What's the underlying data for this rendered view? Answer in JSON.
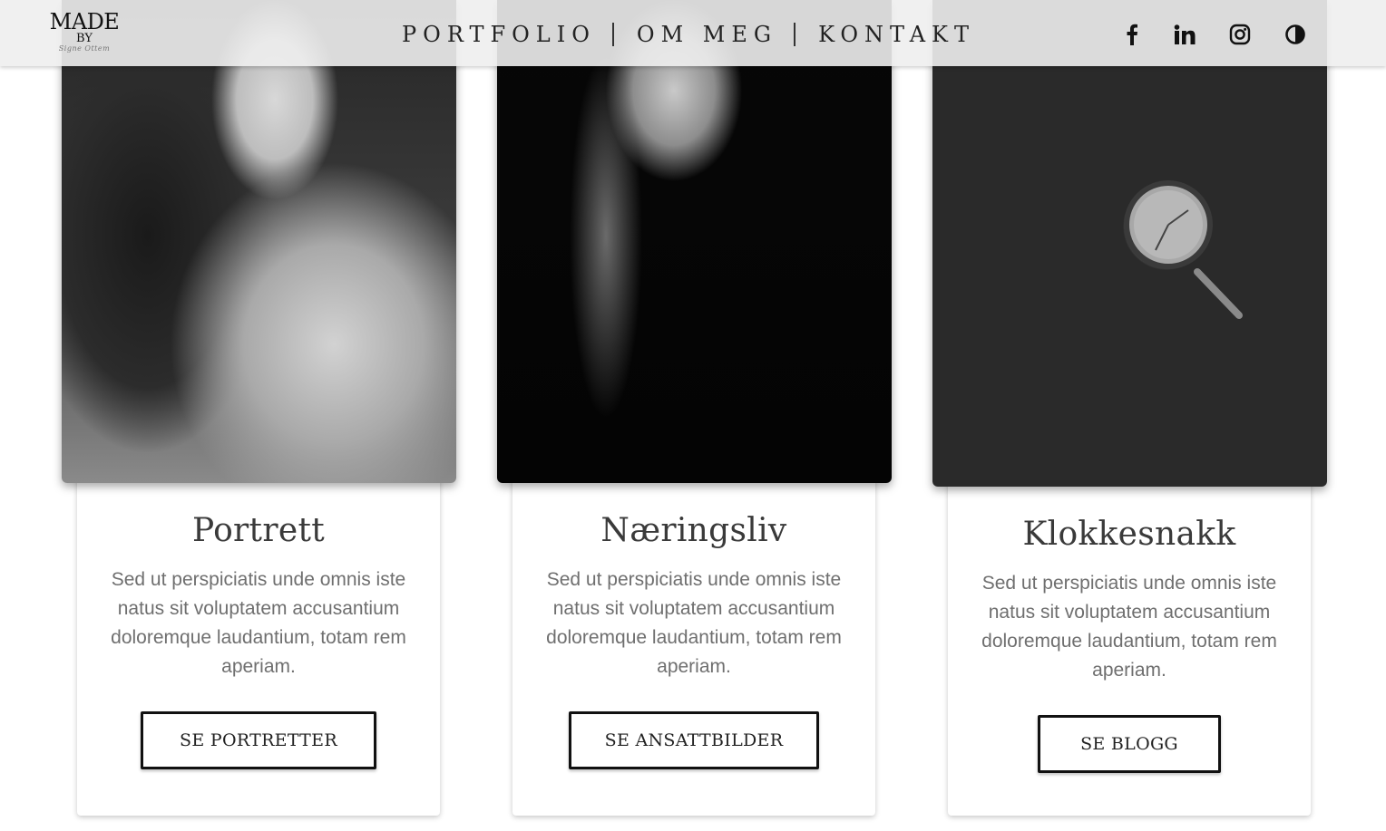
{
  "header": {
    "logo": {
      "line1": "MADE",
      "line2": "BY",
      "signature": "Signe Ottem"
    },
    "nav": [
      {
        "label": "PORTFOLIO"
      },
      {
        "label": "OM MEG"
      },
      {
        "label": "KONTAKT"
      }
    ],
    "social": [
      "facebook-icon",
      "linkedin-icon",
      "instagram-icon",
      "contrast-icon"
    ]
  },
  "cards": [
    {
      "title": "Portrett",
      "text": "Sed ut perspiciatis unde omnis iste natus sit voluptatem accusantium doloremque laudantium, totam rem aperiam.",
      "button": "SE PORTRETTER"
    },
    {
      "title": "Næringsliv",
      "text": "Sed ut perspiciatis unde omnis iste natus sit voluptatem accusantium doloremque laudantium, totam rem aperiam.",
      "button": "SE ANSATTBILDER"
    },
    {
      "title": "Klokkesnakk",
      "text": "Sed ut perspiciatis unde omnis iste natus sit voluptatem accusantium doloremque laudantium, totam rem aperiam.",
      "button": "SE BLOGG"
    }
  ],
  "colors": {
    "navbar": "#eeeeee",
    "text": "#3a3a3a",
    "body_text": "#6f6f6f",
    "button_border": "#111111"
  }
}
